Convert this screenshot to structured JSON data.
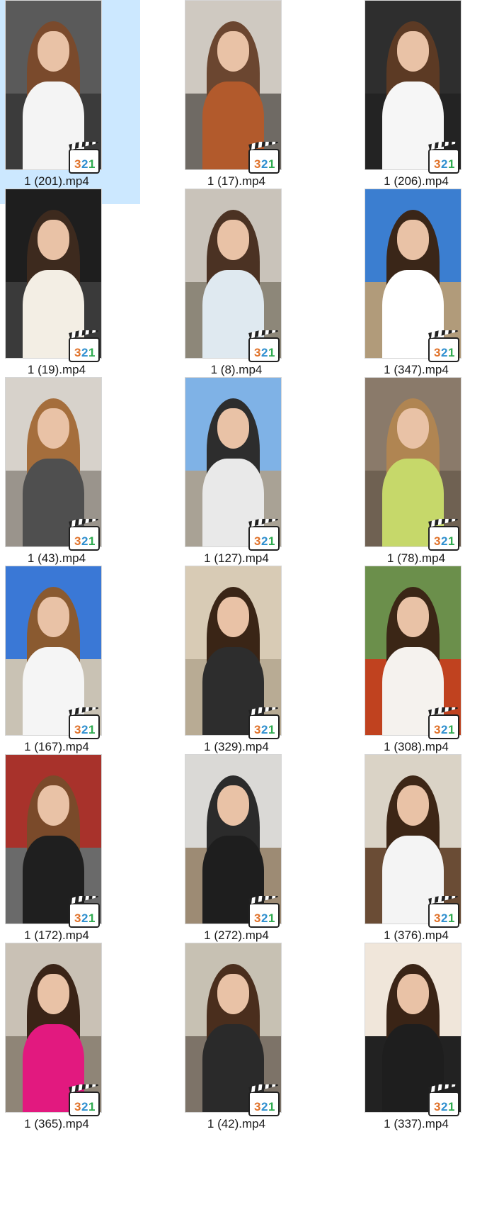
{
  "files": [
    {
      "name": "1 (201).mp4",
      "selected": true,
      "colors": {
        "sky": "#5a5a5a",
        "ground": "#3b3b3b",
        "hair": "#7a4a2c",
        "body": "#f4f4f4"
      }
    },
    {
      "name": "1 (17).mp4",
      "selected": false,
      "colors": {
        "sky": "#cfc9c1",
        "ground": "#6f6a64",
        "hair": "#6b4630",
        "body": "#b25a2c"
      }
    },
    {
      "name": "1 (206).mp4",
      "selected": false,
      "colors": {
        "sky": "#2e2e2e",
        "ground": "#232323",
        "hair": "#5c3a24",
        "body": "#f6f6f6"
      }
    },
    {
      "name": "1 (19).mp4",
      "selected": false,
      "colors": {
        "sky": "#1e1e1e",
        "ground": "#3a3a3a",
        "hair": "#3d2a1e",
        "body": "#f3eee4"
      }
    },
    {
      "name": "1 (8).mp4",
      "selected": false,
      "colors": {
        "sky": "#c9c3ba",
        "ground": "#8d8779",
        "hair": "#4b3223",
        "body": "#dfe9f0"
      }
    },
    {
      "name": "1 (347).mp4",
      "selected": false,
      "colors": {
        "sky": "#3b7ed0",
        "ground": "#b19b7a",
        "hair": "#3a2618",
        "body": "#ffffff"
      }
    },
    {
      "name": "1 (43).mp4",
      "selected": false,
      "colors": {
        "sky": "#d7d2cb",
        "ground": "#9a948c",
        "hair": "#a56e3c",
        "body": "#4f4f4f"
      }
    },
    {
      "name": "1 (127).mp4",
      "selected": false,
      "colors": {
        "sky": "#7fb2e6",
        "ground": "#a9a295",
        "hair": "#2d2d2d",
        "body": "#e9e9e9"
      }
    },
    {
      "name": "1 (78).mp4",
      "selected": false,
      "colors": {
        "sky": "#8a7a6a",
        "ground": "#6f6152",
        "hair": "#b08552",
        "body": "#c6d86a"
      }
    },
    {
      "name": "1 (167).mp4",
      "selected": false,
      "colors": {
        "sky": "#3a78d6",
        "ground": "#c9c2b4",
        "hair": "#8a5a30",
        "body": "#f5f5f5"
      }
    },
    {
      "name": "1 (329).mp4",
      "selected": false,
      "colors": {
        "sky": "#d8cbb5",
        "ground": "#b8ab94",
        "hair": "#3a2516",
        "body": "#2d2d2d"
      }
    },
    {
      "name": "1 (308).mp4",
      "selected": false,
      "colors": {
        "sky": "#6b8f4b",
        "ground": "#c0421f",
        "hair": "#3b2616",
        "body": "#f5f2ee"
      }
    },
    {
      "name": "1 (172).mp4",
      "selected": false,
      "colors": {
        "sky": "#a8322b",
        "ground": "#6a6a6a",
        "hair": "#7a4a2a",
        "body": "#1f1f1f"
      }
    },
    {
      "name": "1 (272).mp4",
      "selected": false,
      "colors": {
        "sky": "#dad9d6",
        "ground": "#9d8b74",
        "hair": "#2b2b2b",
        "body": "#1e1e1e"
      }
    },
    {
      "name": "1 (376).mp4",
      "selected": false,
      "colors": {
        "sky": "#dad3c6",
        "ground": "#6a4c35",
        "hair": "#3d2616",
        "body": "#f4f4f4"
      }
    },
    {
      "name": "1 (365).mp4",
      "selected": false,
      "colors": {
        "sky": "#c9c1b5",
        "ground": "#8f8577",
        "hair": "#3a2417",
        "body": "#e2197f"
      }
    },
    {
      "name": "1 (42).mp4",
      "selected": false,
      "colors": {
        "sky": "#c7c1b3",
        "ground": "#7d7368",
        "hair": "#4a2e1d",
        "body": "#2a2a2a"
      }
    },
    {
      "name": "1 (337).mp4",
      "selected": false,
      "colors": {
        "sky": "#f0e6da",
        "ground": "#222222",
        "hair": "#3a2416",
        "body": "#1e1e1e"
      }
    }
  ],
  "badge": {
    "icon": "media-player-classic-321-icon",
    "digits": [
      "3",
      "2",
      "1"
    ],
    "colors": [
      "#e0722a",
      "#2f8fcf",
      "#2eaa4f"
    ]
  }
}
